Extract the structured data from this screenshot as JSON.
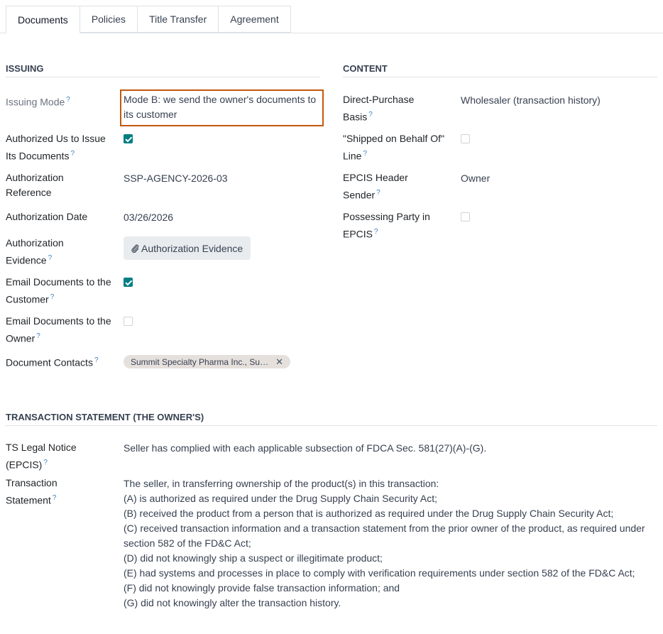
{
  "tabs": [
    {
      "label": "Documents"
    },
    {
      "label": "Policies"
    },
    {
      "label": "Title Transfer"
    },
    {
      "label": "Agreement"
    }
  ],
  "issuing": {
    "title": "ISSUING",
    "issuing_mode_label": "Issuing Mode",
    "issuing_mode_value": "Mode B: we send the owner's documents to its customer",
    "authorized_label_1": "Authorized Us to Issue",
    "authorized_label_2": "Its Documents",
    "authorized_checked": true,
    "auth_ref_label_1": "Authorization",
    "auth_ref_label_2": "Reference",
    "auth_ref_value": "SSP-AGENCY-2026-03",
    "auth_date_label": "Authorization Date",
    "auth_date_value": "03/26/2026",
    "auth_evidence_label_1": "Authorization",
    "auth_evidence_label_2": "Evidence",
    "auth_evidence_button": "Authorization Evidence",
    "email_customer_label_1": "Email Documents to the",
    "email_customer_label_2": "Customer",
    "email_customer_checked": true,
    "email_owner_label_1": "Email Documents to the",
    "email_owner_label_2": "Owner",
    "email_owner_checked": false,
    "doc_contacts_label": "Document Contacts",
    "doc_contacts_tag": "Summit Specialty Pharma Inc., Summit Specialty Pharma Inc."
  },
  "content": {
    "title": "CONTENT",
    "direct_purchase_label_1": "Direct-Purchase",
    "direct_purchase_label_2": "Basis",
    "direct_purchase_value": "Wholesaler (transaction history)",
    "shipped_label_1": "\"Shipped on Behalf Of\"",
    "shipped_label_2": "Line",
    "shipped_checked": false,
    "epcis_header_label_1": "EPCIS Header",
    "epcis_header_label_2": "Sender",
    "epcis_header_value": "Owner",
    "possessing_label_1": "Possessing Party in",
    "possessing_label_2": "EPCIS",
    "possessing_checked": false
  },
  "ts": {
    "title": "TRANSACTION STATEMENT (THE OWNER'S)",
    "legal_label_1": "TS Legal Notice",
    "legal_label_2": "(EPCIS)",
    "legal_value": "Seller has complied with each applicable subsection of FDCA Sec. 581(27)(A)-(G).",
    "statement_label_1": "Transaction",
    "statement_label_2": "Statement",
    "statement_lines": [
      "The seller, in transferring ownership of the product(s) in this transaction:",
      "(A) is authorized as required under the Drug Supply Chain Security Act;",
      "(B) received the product from a person that is authorized as required under the Drug Supply Chain Security Act;",
      "(C) received transaction information and a transaction statement from the prior owner of the product, as required under",
      "section 582 of the FD&C Act;",
      "(D) did not knowingly ship a suspect or illegitimate product;",
      "(E) had systems and processes in place to comply with verification requirements under section 582 of the FD&C Act;",
      "(F) did not knowingly provide false transaction information; and",
      "(G) did not knowingly alter the transaction history."
    ]
  },
  "icons": {
    "help": "question-mark-icon",
    "check": "checkmark-icon",
    "paperclip": "paperclip-icon",
    "remove": "close-icon"
  },
  "colors": {
    "accent": "#017e84",
    "highlight": "#c2580c",
    "help": "#3b82c4"
  }
}
